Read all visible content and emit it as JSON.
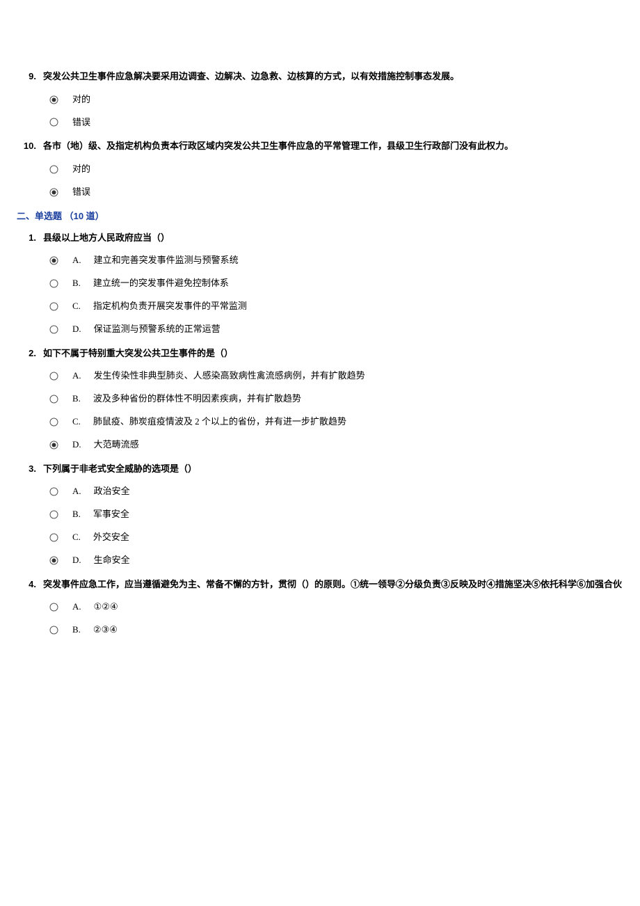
{
  "tf_questions": [
    {
      "number": "9.",
      "text": "突发公共卫生事件应急解决要采用边调查、边解决、边急救、边核算的方式，以有效措施控制事态发展。",
      "options": [
        {
          "label": "对的",
          "selected": true
        },
        {
          "label": "错误",
          "selected": false
        }
      ]
    },
    {
      "number": "10.",
      "text": "各市（地）级、及指定机构负责本行政区域内突发公共卫生事件应急的平常管理工作，县级卫生行政部门没有此权力。",
      "options": [
        {
          "label": "对的",
          "selected": false
        },
        {
          "label": "错误",
          "selected": true
        }
      ]
    }
  ],
  "section_title": "二、单选题 （10 道）",
  "mc_questions": [
    {
      "number": "1.",
      "text": "县级以上地方人民政府应当（）",
      "options": [
        {
          "letter": "A.",
          "label": "建立和完善突发事件监测与预警系统",
          "selected": true
        },
        {
          "letter": "B.",
          "label": "建立统一的突发事件避免控制体系",
          "selected": false
        },
        {
          "letter": "C.",
          "label": "指定机构负责开展突发事件的平常监测",
          "selected": false
        },
        {
          "letter": "D.",
          "label": "保证监测与预警系统的正常运营",
          "selected": false
        }
      ]
    },
    {
      "number": "2.",
      "text": "如下不属于特别重大突发公共卫生事件的是（）",
      "options": [
        {
          "letter": "A.",
          "label": "发生传染性非典型肺炎、人感染高致病性禽流感病例，并有扩散趋势",
          "selected": false
        },
        {
          "letter": "B.",
          "label": "波及多种省份的群体性不明因素疾病，并有扩散趋势",
          "selected": false
        },
        {
          "letter": "C.",
          "label": "肺鼠疫、肺炭疽疫情波及 2 个以上的省份，并有进一步扩散趋势",
          "selected": false
        },
        {
          "letter": "D.",
          "label": "大范畴流感",
          "selected": true
        }
      ]
    },
    {
      "number": "3.",
      "text": "下列属于非老式安全威胁的选项是（）",
      "options": [
        {
          "letter": "A.",
          "label": "政治安全",
          "selected": false
        },
        {
          "letter": "B.",
          "label": "军事安全",
          "selected": false
        },
        {
          "letter": "C.",
          "label": "外交安全",
          "selected": false
        },
        {
          "letter": "D.",
          "label": "生命安全",
          "selected": true
        }
      ]
    },
    {
      "number": "4.",
      "text": "突发事件应急工作，应当遵循避免为主、常备不懈的方针，贯彻（）的原则。①统一领导②分级负责③反映及时④措施坚决⑤依托科学⑥加强合伙",
      "options": [
        {
          "letter": "A.",
          "label": "①②④",
          "selected": false
        },
        {
          "letter": "B.",
          "label": "②③④",
          "selected": false
        }
      ]
    }
  ]
}
